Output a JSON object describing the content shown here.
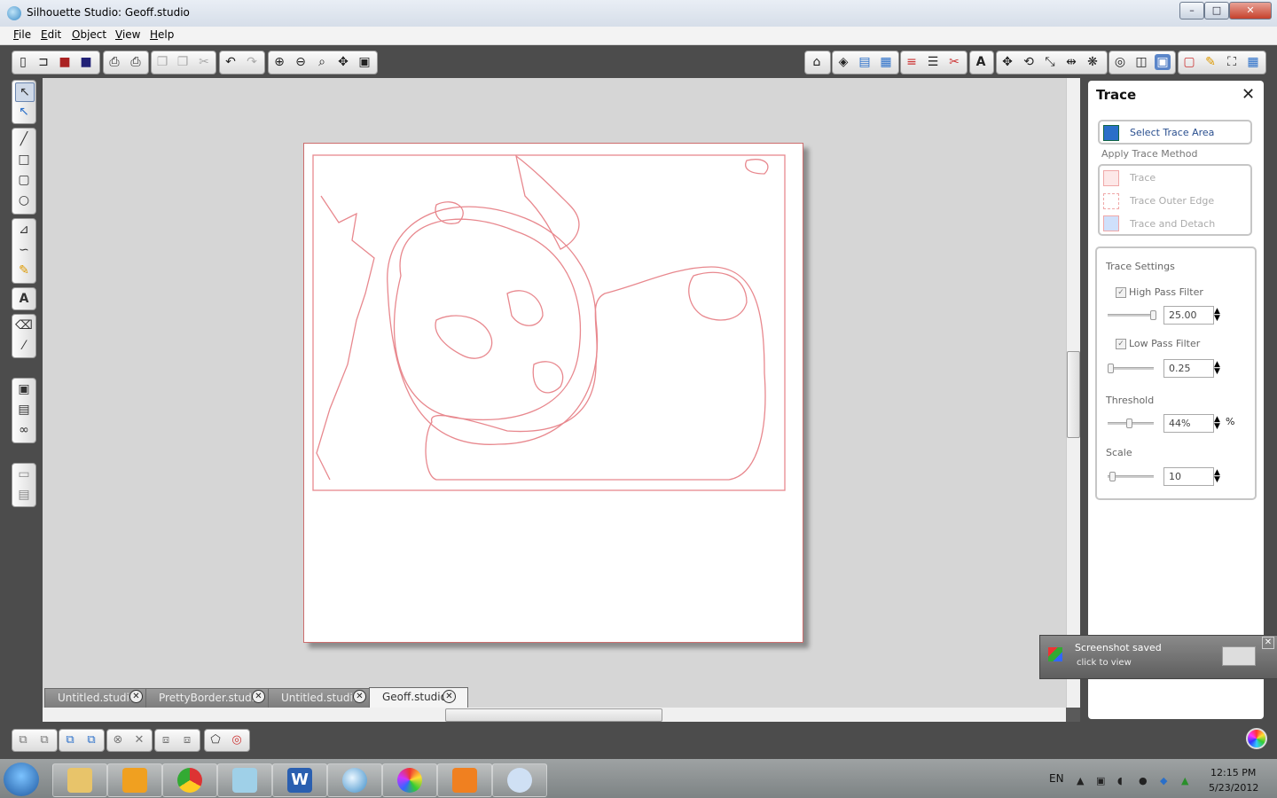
{
  "window": {
    "title": "Silhouette Studio: Geoff.studio",
    "min": "–",
    "max": "□",
    "close": "✕"
  },
  "menu": [
    "File",
    "Edit",
    "Object",
    "View",
    "Help"
  ],
  "tabs": [
    {
      "label": "Untitled.studio",
      "active": false
    },
    {
      "label": "PrettyBorder.studio",
      "active": false
    },
    {
      "label": "Untitled.studio",
      "active": false
    },
    {
      "label": "Geoff.studio",
      "active": true
    }
  ],
  "tab_close": "✕",
  "trace_panel": {
    "title": "Trace",
    "close": "✕",
    "select_area": "Select Trace Area",
    "apply_method": "Apply Trace Method",
    "methods": [
      "Trace",
      "Trace Outer Edge",
      "Trace and Detach"
    ],
    "settings": {
      "heading": "Trace Settings",
      "high_pass_label": "High Pass Filter",
      "high_pass_value": "25.00",
      "low_pass_label": "Low Pass Filter",
      "low_pass_value": "0.25",
      "threshold_label": "Threshold",
      "threshold_value": "44%",
      "threshold_unit": "%",
      "scale_label": "Scale",
      "scale_value": "10",
      "check": "✓"
    }
  },
  "toast": {
    "title": "Screenshot saved",
    "subtitle": "click to view",
    "close": "✕"
  },
  "taskbar": {
    "lang": "EN",
    "time": "12:15 PM",
    "date": "5/23/2012",
    "word_letter": "W"
  },
  "colors": {
    "trace_line": "#e8888e",
    "canvas_bg": "#d6d6d6",
    "chrome": "#4c4c4c"
  }
}
